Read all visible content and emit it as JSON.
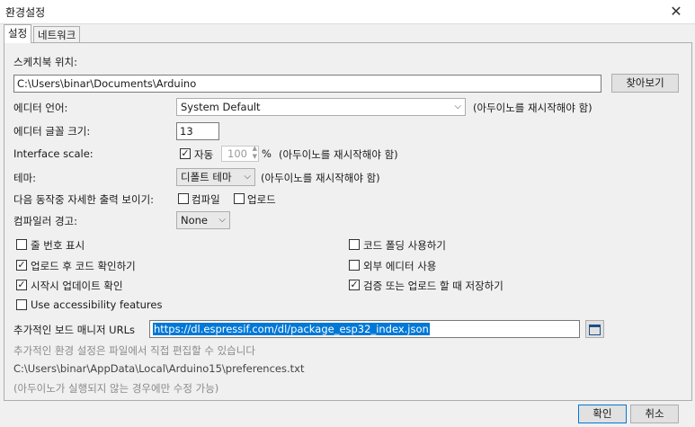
{
  "window": {
    "title": "환경설정"
  },
  "tabs": [
    {
      "label": "설정"
    },
    {
      "label": "네트워크"
    }
  ],
  "sketchbook": {
    "label": "스케치북 위치:",
    "path": "C:\\Users\\binar\\Documents\\Arduino",
    "browse_label": "찾아보기"
  },
  "editor_language": {
    "label": "에디터 언어:",
    "value": "System Default",
    "note": "(아두이노를 재시작해야 함)"
  },
  "font_size": {
    "label": "에디터 글꼴 크기:",
    "value": "13"
  },
  "interface_scale": {
    "label": "Interface scale:",
    "auto_label": "자동",
    "auto_checked": true,
    "value": "100",
    "unit": "%",
    "note": "(아두이노를 재시작해야 함)"
  },
  "theme": {
    "label": "테마:",
    "value": "디폴트 테마",
    "note": "(아두이노를 재시작해야 함)"
  },
  "verbose_output": {
    "label": "다음 동작중 자세한  출력 보이기:",
    "compile_label": "컴파일",
    "upload_label": "업로드"
  },
  "compiler_warnings": {
    "label": "컴파일러 경고:",
    "value": "None"
  },
  "options": {
    "line_numbers": "줄 번호 표시",
    "code_folding": "코드 폴딩 사용하기",
    "verify_after_upload": "업로드 후 코드 확인하기",
    "external_editor": "외부 에디터 사용",
    "check_updates": "시작시 업데이트 확인",
    "save_on_verify": "검증 또는 업로드 할 때 저장하기",
    "accessibility": "Use accessibility features"
  },
  "board_manager": {
    "label": "추가적인 보드 매니저 URLs",
    "url": "https://dl.espressif.com/dl/package_esp32_index.json"
  },
  "info": {
    "line1": "추가적인 환경 설정은 파일에서 직접 편집할 수 있습니다",
    "line2": "C:\\Users\\binar\\AppData\\Local\\Arduino15\\preferences.txt",
    "line3": "(아두이노가 실행되지 않는 경우에만 수정 가능)"
  },
  "buttons": {
    "ok": "확인",
    "cancel": "취소"
  }
}
